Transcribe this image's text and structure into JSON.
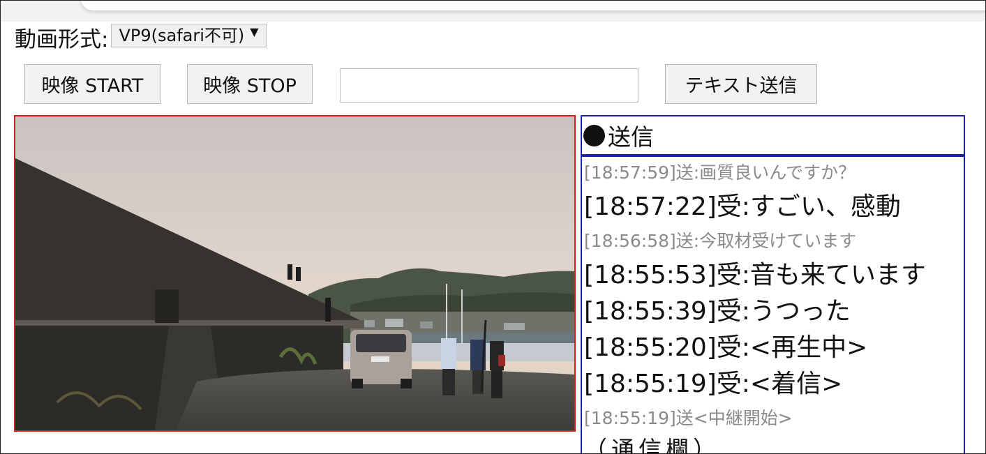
{
  "format": {
    "label": "動画形式:",
    "selected": "VP9(safari不可)",
    "arrow_icon": "triangle-down-icon"
  },
  "toolbar": {
    "start_label": "映像 START",
    "stop_label": "映像 STOP",
    "text_input_value": "",
    "send_label": "テキスト送信"
  },
  "chat": {
    "header": "送信",
    "border_color": "#1a22a8",
    "messages": [
      {
        "type": "sent",
        "text": "[18:57:59]送:画質良いんですか？"
      },
      {
        "type": "recv",
        "text": "[18:57:22]受:すごい、感動"
      },
      {
        "type": "sent",
        "text": "[18:56:58]送:今取材受けています"
      },
      {
        "type": "recv",
        "text": "[18:55:53]受:音も来ています"
      },
      {
        "type": "recv",
        "text": "[18:55:39]受:うつった"
      },
      {
        "type": "recv",
        "text": "[18:55:20]受:<再生中>"
      },
      {
        "type": "recv",
        "text": "[18:55:19]受:<着信>"
      },
      {
        "type": "sent",
        "text": "[18:55:19]送<中継開始>"
      }
    ],
    "footer": "（通信欄）"
  },
  "video": {
    "border_color": "#d32020",
    "content": "outdoor-harbor-scene"
  }
}
